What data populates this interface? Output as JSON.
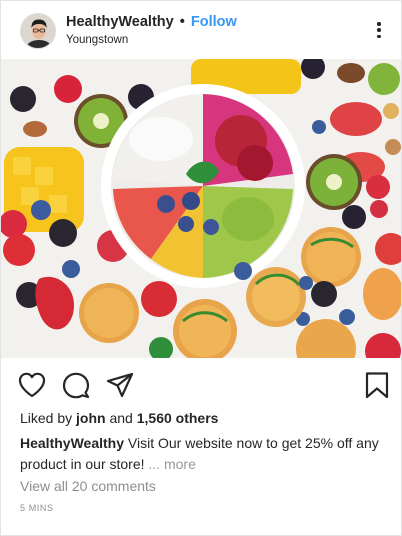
{
  "post": {
    "username": "HealthyWealthy",
    "separator": "•",
    "follow_label": "Follow",
    "location": "Youngstown",
    "likes_prefix": "Liked by",
    "likes_user": "john",
    "likes_joiner": "and",
    "likes_others": "1,560 others",
    "caption_user": "HealthyWealthy",
    "caption_text": "Visit Our website now to get 25% off any product in our store!",
    "caption_more": "... more",
    "view_comments": "View all 20 comments",
    "timestamp": "5 MINS"
  },
  "icons": {
    "like": "heart-icon",
    "comment": "comment-bubble-icon",
    "share": "paper-plane-icon",
    "save": "bookmark-icon",
    "options": "more-vertical-icon"
  },
  "colors": {
    "follow": "#3897f0",
    "text": "#262626",
    "muted": "#8e8e8e"
  }
}
